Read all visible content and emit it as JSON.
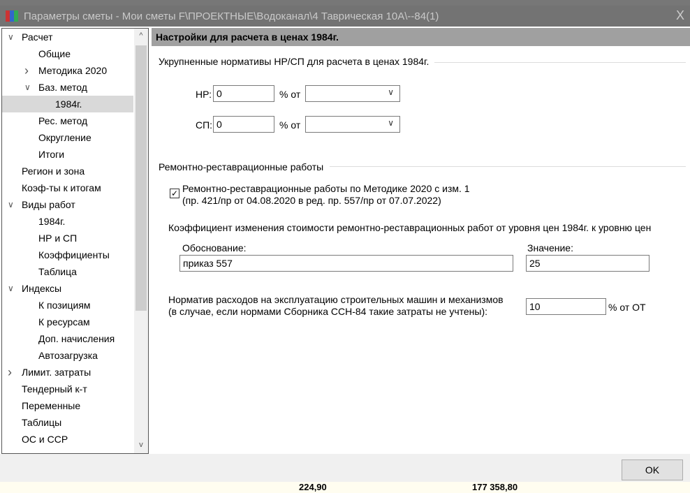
{
  "window": {
    "title": "Параметры сметы - Мои сметы F\\ПРОЕКТНЫЕ\\Водоканал\\4 Таврическая 10А\\--84(1)",
    "close": "X"
  },
  "tree": [
    {
      "label": "Расчет",
      "level": 0,
      "chev": "v"
    },
    {
      "label": "Общие",
      "level": 1,
      "chev": ""
    },
    {
      "label": "Методика 2020",
      "level": 1,
      "chev": ">"
    },
    {
      "label": "Баз. метод",
      "level": 1,
      "chev": "v"
    },
    {
      "label": "1984г.",
      "level": 2,
      "chev": "",
      "selected": true
    },
    {
      "label": "Рес. метод",
      "level": 1,
      "chev": ""
    },
    {
      "label": "Округление",
      "level": 1,
      "chev": ""
    },
    {
      "label": "Итоги",
      "level": 1,
      "chev": ""
    },
    {
      "label": "Регион и зона",
      "level": 0,
      "chev": ""
    },
    {
      "label": "Коэф-ты к итогам",
      "level": 0,
      "chev": ""
    },
    {
      "label": "Виды работ",
      "level": 0,
      "chev": "v"
    },
    {
      "label": "1984г.",
      "level": 1,
      "chev": ""
    },
    {
      "label": "НР и СП",
      "level": 1,
      "chev": ""
    },
    {
      "label": "Коэффициенты",
      "level": 1,
      "chev": ""
    },
    {
      "label": "Таблица",
      "level": 1,
      "chev": ""
    },
    {
      "label": "Индексы",
      "level": 0,
      "chev": "v"
    },
    {
      "label": "К позициям",
      "level": 1,
      "chev": ""
    },
    {
      "label": "К ресурсам",
      "level": 1,
      "chev": ""
    },
    {
      "label": "Доп. начисления",
      "level": 1,
      "chev": ""
    },
    {
      "label": "Автозагрузка",
      "level": 1,
      "chev": ""
    },
    {
      "label": "Лимит. затраты",
      "level": 0,
      "chev": ">"
    },
    {
      "label": "Тендерный к-т",
      "level": 0,
      "chev": ""
    },
    {
      "label": "Переменные",
      "level": 0,
      "chev": ""
    },
    {
      "label": "Таблицы",
      "level": 0,
      "chev": ""
    },
    {
      "label": "ОС и ССР",
      "level": 0,
      "chev": ""
    }
  ],
  "content": {
    "header": "Настройки для расчета в ценах 1984г.",
    "sect1": "Укрупненные нормативы НР/СП для расчета в ценах 1984г.",
    "nr_label": "НР:",
    "nr_value": "0",
    "nr_pct": "% от",
    "sp_label": "СП:",
    "sp_value": "0",
    "sp_pct": "% от",
    "sect2": "Ремонтно-реставрационные работы",
    "check_line1": "Ремонтно-реставрационные работы по Методике 2020 с изм. 1",
    "check_line2": "(пр. 421/пр от 04.08.2020 в ред. пр. 557/пр от 07.07.2022)",
    "coef_text": "Коэффициент изменения стоимости ремонтно-реставрационных работ от уровня цен 1984г. к уровню цен",
    "basis_label": "Обоснование:",
    "basis_value": "приказ 557",
    "value_label": "Значение:",
    "value_value": "25",
    "norm_line1": "Норматив расходов на эксплуатацию строительных машин и механизмов",
    "norm_line2": "(в случае, если нормами Сборника ССН-84 такие затраты не учтены):",
    "norm_value": "10",
    "norm_unit": "% от ОТ"
  },
  "footer": {
    "ok": "OK"
  },
  "bottom": {
    "v1": "224,90",
    "v2": "177 358,80"
  }
}
